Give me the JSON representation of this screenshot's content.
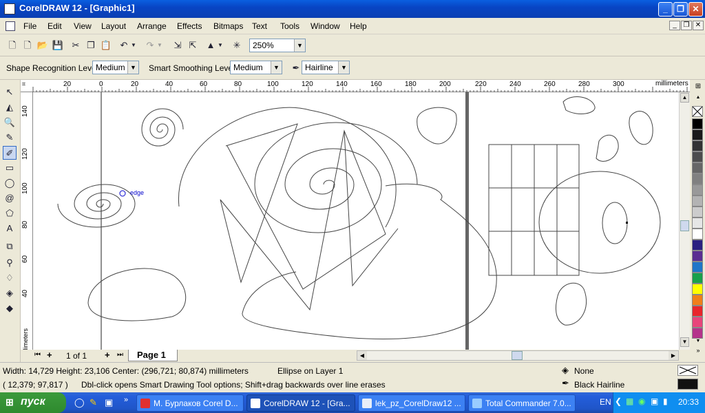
{
  "window": {
    "title": "CorelDRAW 12 - [Graphic1]",
    "minimize": "_",
    "maximize": "❐",
    "close": "✕"
  },
  "menu": {
    "items": [
      "File",
      "Edit",
      "View",
      "Layout",
      "Arrange",
      "Effects",
      "Bitmaps",
      "Text",
      "Tools",
      "Window",
      "Help"
    ]
  },
  "standard_toolbar": {
    "zoom_value": "250%"
  },
  "property_bar": {
    "shape_recognition_label": "Shape Recognition Level:",
    "shape_recognition_value": "Medium",
    "smart_smoothing_label": "Smart Smoothing Level:",
    "smart_smoothing_value": "Medium",
    "outline_width_value": "Hairline"
  },
  "rulers": {
    "unit": "millimeters",
    "h_ticks": [
      "20",
      "0",
      "20",
      "40",
      "60",
      "80",
      "100",
      "120",
      "140",
      "160",
      "180",
      "200",
      "220",
      "240",
      "260",
      "280",
      "300"
    ],
    "v_ticks": [
      "140",
      "120",
      "100",
      "80",
      "60",
      "40"
    ]
  },
  "canvas": {
    "snap_label": "edge"
  },
  "page_nav": {
    "page_count": "1 of 1",
    "page_tab": "Page 1"
  },
  "status": {
    "dimensions": "Width: 14,729  Height: 23,106  Center: (296,721; 80,874)  millimeters",
    "object_info": "Ellipse on Layer 1",
    "cursor_pos": "( 12,379; 97,817 )",
    "hint": "Dbl-click opens Smart Drawing Tool options; Shift+drag backwards over line erases",
    "fill": "None",
    "outline": "Black  Hairline"
  },
  "palette_colors": [
    "#000000",
    "#1a1a1a",
    "#333333",
    "#4d4d4d",
    "#666666",
    "#808080",
    "#999999",
    "#b3b3b3",
    "#cccccc",
    "#e6e6e6",
    "#ffffff",
    "#2b2080",
    "#5b2d91",
    "#1f76c8",
    "#19a04b",
    "#ffff00",
    "#f07f1a",
    "#e8262b",
    "#e8457a",
    "#b5338a"
  ],
  "taskbar": {
    "start_label": "пуск",
    "tasks": [
      "М. Бурлаков Corel D...",
      "CorelDRAW 12 - [Gra...",
      "lek_pz_CorelDraw12 ...",
      "Total Commander 7.0..."
    ],
    "lang": "EN",
    "clock": "20:33"
  }
}
